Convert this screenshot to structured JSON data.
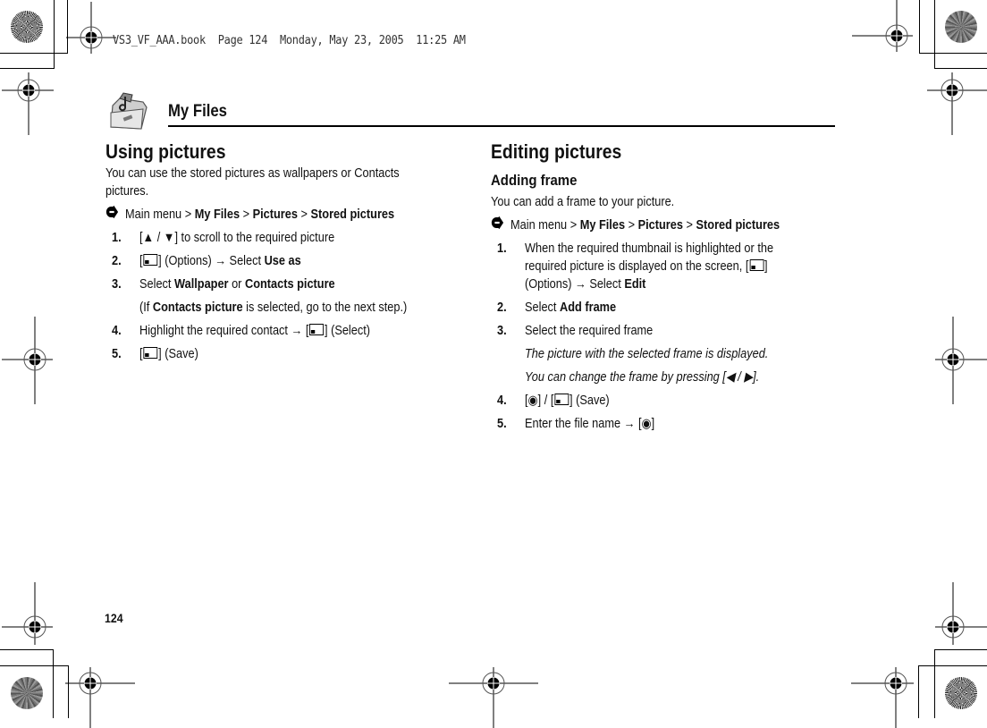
{
  "slug_line": "VS3_VF_AAA.book  Page 124  Monday, May 23, 2005  11:25 AM",
  "header": {
    "title": "My Files",
    "icon": "folder-music-icon"
  },
  "left": {
    "title": "Using pictures",
    "intro": "You can use the stored pictures as wallpapers or Contacts pictures.",
    "path": {
      "prefix": "Main menu",
      "sep": ">",
      "items": [
        "My Files",
        "Pictures",
        "Stored pictures"
      ]
    },
    "steps": [
      {
        "num": "1.",
        "pre": "[▲ / ▼] to scroll to the required picture"
      },
      {
        "num": "2.",
        "key": "soft-key",
        "pre": "] (Options) → Select ",
        "bold": "Use as"
      },
      {
        "num": "3.",
        "pre": "Select ",
        "bold": "Wallpaper",
        "mid": " or ",
        "bold2": "Contacts picture",
        "note_pre": "(If ",
        "note_bold": "Contacts picture",
        "note_post": " is selected, go to the next step.)"
      },
      {
        "num": "4.",
        "pre": "Highlight the required contact → [",
        "post": "] (Select)"
      },
      {
        "num": "5.",
        "post": "] (Save)"
      }
    ]
  },
  "right": {
    "title": "Editing pictures",
    "subtitle": "Adding frame",
    "intro": "You can add a frame to your picture.",
    "path": {
      "prefix": "Main menu",
      "sep": ">",
      "items": [
        "My Files",
        "Pictures",
        "Stored pictures"
      ]
    },
    "steps": [
      {
        "num": "1.",
        "pre": "When the required thumbnail is highlighted or the required picture is displayed on the screen, [",
        "post": "] (Options) → Select ",
        "bold": "Edit"
      },
      {
        "num": "2.",
        "pre": "Select ",
        "bold": "Add frame"
      },
      {
        "num": "3.",
        "pre": "Select the required frame",
        "note1": "The picture with the selected frame is displayed.",
        "note2": "You can change the frame by pressing [◀ / ▶]."
      },
      {
        "num": "4.",
        "pre": "[◉] / [",
        "post": "] (Save)"
      },
      {
        "num": "5.",
        "pre": "Enter the file name → [◉]"
      }
    ]
  },
  "page_number": "124"
}
